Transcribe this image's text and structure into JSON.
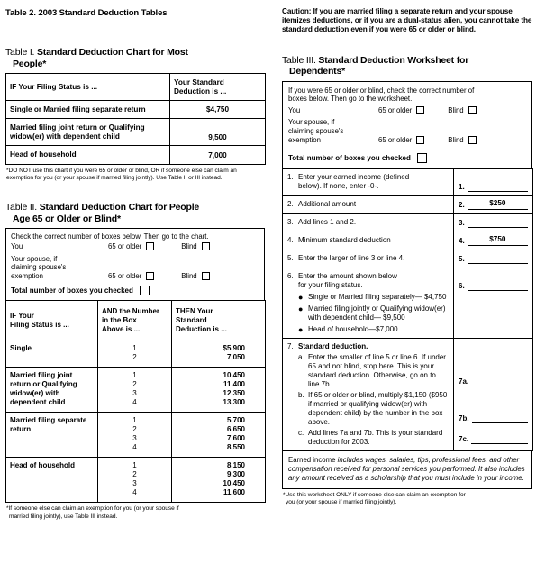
{
  "document": {
    "title": "Table 2. 2003 Standard Deduction Tables"
  },
  "caution": {
    "text": "Caution: If you are married filing a separate return and your spouse itemizes deductions, or if you are a dual-status alien, you cannot take the standard deduction even if you were 65 or older or blind."
  },
  "table1": {
    "label": "Table I.",
    "title_line1": "Standard Deduction Chart for Most",
    "title_line2": "People*",
    "headers": {
      "status": "IF Your Filing Status is ...",
      "amount_line1": "Your Standard",
      "amount_line2": "Deduction is ..."
    },
    "rows": [
      {
        "status": "Single or Married filing separate return",
        "amount": "$4,750"
      },
      {
        "status": "Married filing joint return or Qualifying widow(er) with dependent child",
        "amount": "9,500"
      },
      {
        "status": "Head of household",
        "amount": "7,000"
      }
    ],
    "footnote_line1": "*DO NOT use this chart if you were 65 or older or blind, OR if someone",
    "footnote_line2": "else can claim an exemption for you (or your spouse if married filing",
    "footnote_line3": "jointly). Use Table II or III instead."
  },
  "table2": {
    "label": "Table II.",
    "title_line1": "Standard Deduction Chart for People",
    "title_line2": "Age 65 or Older or Blind*",
    "checkpanel": {
      "intro": "Check the correct number of boxes below. Then go to the chart.",
      "you_label": "You",
      "spouse_label_line1": "Your spouse, if",
      "spouse_label_line2": "claiming spouse's",
      "spouse_label_line3": "exemption",
      "option_age": "65 or older",
      "option_blind": "Blind",
      "total_label": "Total number of boxes you checked"
    },
    "headers": {
      "status_line1": "IF Your",
      "status_line2": "Filing Status is ...",
      "boxnum_line1": "AND the Number",
      "boxnum_line2": "in the Box",
      "boxnum_line3": "Above is ...",
      "deduction_line1": "THEN Your",
      "deduction_line2": "Standard",
      "deduction_line3": "Deduction is ..."
    },
    "rows": [
      {
        "status": "Single",
        "numbers": [
          "1",
          "2"
        ],
        "values": [
          "$5,900",
          "7,050"
        ]
      },
      {
        "status": "Married filing joint return or Qualifying widow(er) with dependent child",
        "numbers": [
          "1",
          "2",
          "3",
          "4"
        ],
        "values": [
          "10,450",
          "11,400",
          "12,350",
          "13,300"
        ]
      },
      {
        "status": "Married filing separate return",
        "numbers": [
          "1",
          "2",
          "3",
          "4"
        ],
        "values": [
          "5,700",
          "6,650",
          "7,600",
          "8,550"
        ]
      },
      {
        "status": "Head of household",
        "numbers": [
          "1",
          "2",
          "3",
          "4"
        ],
        "values": [
          "8,150",
          "9,300",
          "10,450",
          "11,600"
        ]
      }
    ],
    "footnote_line1": "*If someone else can claim an exemption for you (or your spouse if",
    "footnote_line2": "married filing jointly), use Table III instead."
  },
  "table3": {
    "label": "Table III.",
    "title_line1": "Standard Deduction Worksheet for",
    "title_line2": "Dependents*",
    "checkpanel": {
      "intro_line1": "If you were 65 or older or blind, check the correct number of",
      "intro_line2": "boxes below. Then go to the worksheet.",
      "you_label": "You",
      "spouse_label_line1": "Your spouse, if",
      "spouse_label_line2": "claiming spouse's",
      "spouse_label_line3": "exemption",
      "option_age": "65 or older",
      "option_blind": "Blind",
      "total_label": "Total number of boxes you checked"
    },
    "lines": [
      {
        "no": "1.",
        "text_line1": "Enter your earned income (defined",
        "text_line2": "below). If none, enter -0-.",
        "amt_label": "1.",
        "amt_value": ""
      },
      {
        "no": "2.",
        "text_line1": "Additional amount",
        "amt_label": "2.",
        "amt_value": "$250"
      },
      {
        "no": "3.",
        "text_line1": "Add lines 1 and 2.",
        "amt_label": "3.",
        "amt_value": ""
      },
      {
        "no": "4.",
        "text_line1": "Minimum standard deduction",
        "amt_label": "4.",
        "amt_value": "$750"
      },
      {
        "no": "5.",
        "text_line1": "Enter the larger of line 3 or line 4.",
        "amt_label": "5.",
        "amt_value": ""
      }
    ],
    "line6": {
      "no": "6.",
      "text_line1": "Enter the amount shown below",
      "text_line2": "for your filing status.",
      "bullets": [
        "Single or Married filing separately— $4,750",
        "Married filing jointly or Qualifying widow(er) with dependent child— $9,500",
        "Head of household—$7,000"
      ],
      "amt_label": "6.",
      "amt_value": ""
    },
    "line7": {
      "no": "7.",
      "title": "Standard deduction.",
      "a": {
        "letter": "a.",
        "text": "Enter the smaller of line 5 or line 6. If under 65 and not blind, stop here. This is your standard deduction. Otherwise, go on to line 7b.",
        "amt_label": "7a.",
        "amt_value": ""
      },
      "b": {
        "letter": "b.",
        "text": "If 65 or older or blind, multiply $1,150 ($950 if married or qualifying widow(er) with dependent child) by the number in the box above.",
        "amt_label": "7b.",
        "amt_value": ""
      },
      "c": {
        "letter": "c.",
        "text": "Add lines 7a and 7b. This is your standard deduction for 2003.",
        "amt_label": "7c.",
        "amt_value": ""
      }
    },
    "earned_income_note": {
      "lead": "Earned income",
      "rest": " includes wages, salaries, tips, professional fees, and other compensation received for personal services you performed. It also includes any amount received as a scholarship that you must include in your income."
    },
    "footnote_line1": "*Use this worksheet ONLY if someone else can claim an exemption for",
    "footnote_line2": "you (or your spouse if married filing jointly)."
  }
}
